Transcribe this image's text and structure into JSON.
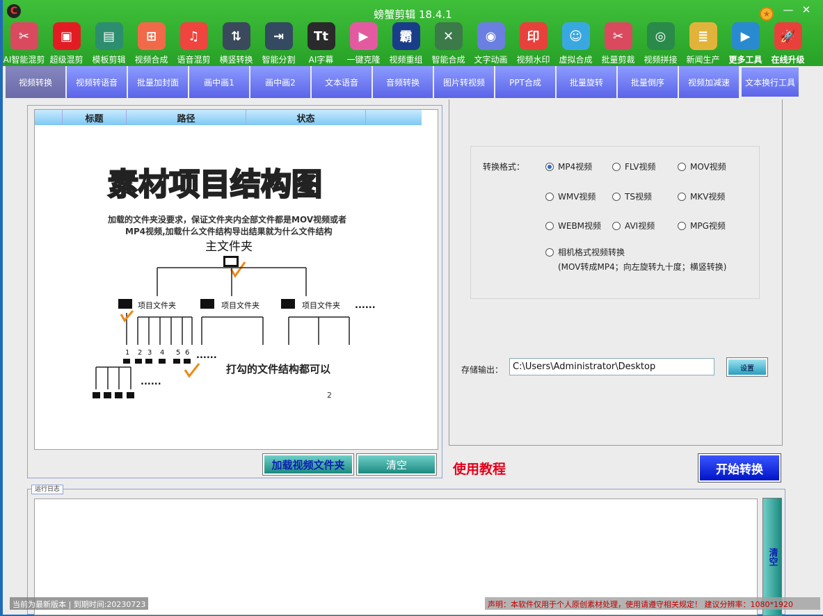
{
  "window": {
    "title": "螃蟹剪辑 18.4.1",
    "logo_text": "C"
  },
  "toolbar": [
    {
      "label": "AI智能混剪",
      "icon": "film-reel-icon",
      "color": "#d94a5f",
      "glyph": "✂"
    },
    {
      "label": "超级混剪",
      "icon": "gift-box-icon",
      "color": "#e31c23",
      "glyph": "▣"
    },
    {
      "label": "模板剪辑",
      "icon": "template-icon",
      "color": "#2c8e6e",
      "glyph": "▤"
    },
    {
      "label": "视频合成",
      "icon": "grid-icon",
      "color": "#f06a4a",
      "glyph": "⊞"
    },
    {
      "label": "语音混剪",
      "icon": "music-note-icon",
      "color": "#f0443e",
      "glyph": "♫"
    },
    {
      "label": "横竖转换",
      "icon": "rotate-arrows-icon",
      "color": "#3a4a5c",
      "glyph": "⇅"
    },
    {
      "label": "智能分割",
      "icon": "split-arrow-icon",
      "color": "#344a60",
      "glyph": "⇥"
    },
    {
      "label": "AI字幕",
      "icon": "text-tt-icon",
      "color": "#2a2a2a",
      "glyph": "Tt"
    },
    {
      "label": "一键克隆",
      "icon": "video-clone-icon",
      "color": "#e45aa0",
      "glyph": "▶"
    },
    {
      "label": "视频重组",
      "icon": "ba-character-icon",
      "color": "#1a3d8a",
      "glyph": "霸"
    },
    {
      "label": "智能合成",
      "icon": "scissors-icon",
      "color": "#3d7a4a",
      "glyph": "✕"
    },
    {
      "label": "文字动画",
      "icon": "sound-wave-icon",
      "color": "#6a7fe0",
      "glyph": "◉"
    },
    {
      "label": "视频水印",
      "icon": "watermark-icon",
      "color": "#e8413c",
      "glyph": "印"
    },
    {
      "label": "虚拟合成",
      "icon": "avatar-icon",
      "color": "#3aa8e0",
      "glyph": "☺"
    },
    {
      "label": "批量剪裁",
      "icon": "film-crop-icon",
      "color": "#d94a5f",
      "glyph": "✂"
    },
    {
      "label": "视频拼接",
      "icon": "camera-icon",
      "color": "#2a8a4a",
      "glyph": "◎"
    },
    {
      "label": "新闻生产",
      "icon": "newspaper-icon",
      "color": "#e2b33a",
      "glyph": "≣"
    },
    {
      "label": "更多工具",
      "icon": "more-tools-icon",
      "color": "#2a8ad0",
      "glyph": "▶",
      "bold": true
    },
    {
      "label": "在线升级",
      "icon": "rocket-icon",
      "color": "#e8413c",
      "glyph": "🚀",
      "bold": true
    }
  ],
  "tabs": [
    "视频转换",
    "视频转语音",
    "批量加封面",
    "画中画1",
    "画中画2",
    "文本语音",
    "音频转换",
    "图片转视频",
    "PPT合成",
    "批量旋转",
    "批量倒序",
    "视频加减速",
    "文本换行工具"
  ],
  "table": {
    "headers": [
      "标题",
      "路径",
      "状态"
    ]
  },
  "diagram": {
    "title": "素材项目结构图",
    "note_line1": "加载的文件夹没要求，保证文件夹内全部文件都是MOV视频或者",
    "note_line2": "MP4视频,加载什么文件结构导出结果就为什么文件结构",
    "root_label": "主文件夹",
    "folder_label": "项目文件夹",
    "ellipsis": "......",
    "ellipsis_small": "......",
    "numbers": [
      "1",
      "2",
      "3",
      "4",
      "5",
      "6"
    ],
    "tick_note": "打勾的文件结构都可以",
    "mark": "2"
  },
  "left_buttons": {
    "load": "加载视频文件夹",
    "clear": "清空"
  },
  "tutorial": "使用教程",
  "format": {
    "label": "转换格式：",
    "options": [
      "MP4视频",
      "FLV视频",
      "MOV视频",
      "WMV视频",
      "TS视频",
      "MKV视频",
      "WEBM视频",
      "AVI视频",
      "MPG视频",
      "相机格式视频转换"
    ],
    "selected": "MP4视频",
    "camera_note": "(MOV转成MP4；向左旋转九十度；横竖转换)"
  },
  "output": {
    "label": "存储输出：",
    "value": "C:\\Users\\Administrator\\Desktop",
    "set_label": "设置"
  },
  "start_button": "开始转换",
  "log": {
    "title": "运行日志",
    "clear": "清空"
  },
  "status": {
    "left": "当前为最新版本 | 到期时间:20230723",
    "right": "声明：本软件仅用于个人原创素材处理，使用请遵守相关规定！ 建议分辨率：1080*1920"
  }
}
